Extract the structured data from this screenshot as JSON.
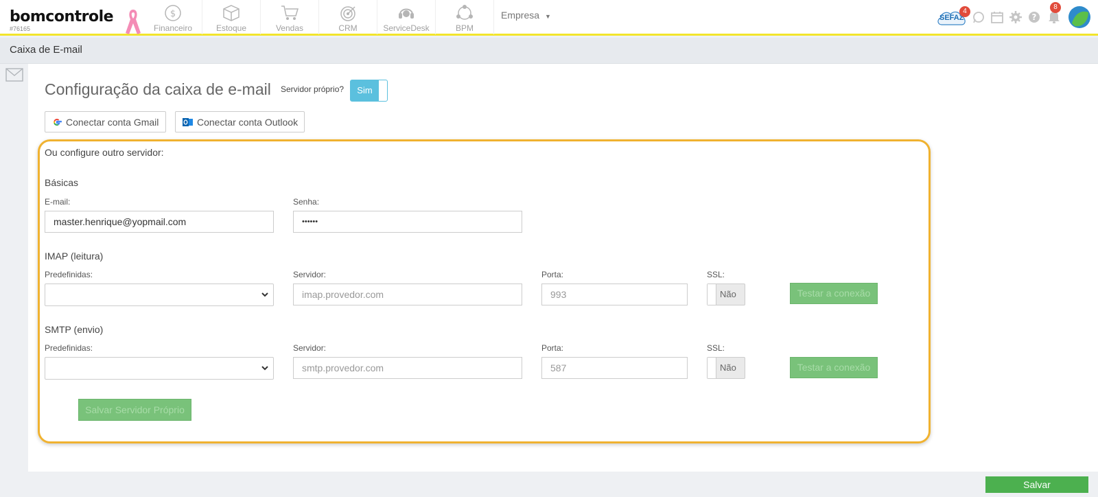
{
  "app": {
    "logo": "bomcontrole",
    "account_code": "#76165",
    "modules": [
      {
        "label": "Financeiro",
        "icon": "dollar-circle-icon"
      },
      {
        "label": "Estoque",
        "icon": "box-icon"
      },
      {
        "label": "Vendas",
        "icon": "cart-icon"
      },
      {
        "label": "CRM",
        "icon": "target-icon"
      },
      {
        "label": "ServiceDesk",
        "icon": "headset-icon"
      },
      {
        "label": "BPM",
        "icon": "network-icon"
      }
    ],
    "company_menu": "Empresa",
    "sefaz_label": "SEFAZ",
    "sefaz_badge": "4",
    "notifications_badge": "8"
  },
  "page": {
    "title": "Caixa de E-mail",
    "heading": "Configuração da caixa de e-mail",
    "own_server_label": "Servidor próprio?",
    "own_server_toggle": "Sim",
    "gmail_button": "Conectar conta Gmail",
    "outlook_button": "Conectar conta Outlook",
    "other_server_label": "Ou configure outro servidor:"
  },
  "basic": {
    "section": "Básicas",
    "email_label": "E-mail:",
    "email_value": "master.henrique@yopmail.com",
    "password_label": "Senha:",
    "password_value": "••••••"
  },
  "imap": {
    "section": "IMAP (leitura)",
    "preset_label": "Predefinidas:",
    "preset_value": "",
    "server_label": "Servidor:",
    "server_placeholder": "imap.provedor.com",
    "port_label": "Porta:",
    "port_placeholder": "993",
    "ssl_label": "SSL:",
    "ssl_value": "Não",
    "test_button": "Testar a conexão"
  },
  "smtp": {
    "section": "SMTP (envio)",
    "preset_label": "Predefinidas:",
    "preset_value": "",
    "server_label": "Servidor:",
    "server_placeholder": "smtp.provedor.com",
    "port_label": "Porta:",
    "port_placeholder": "587",
    "ssl_label": "SSL:",
    "ssl_value": "Não",
    "test_button": "Testar a conexão"
  },
  "actions": {
    "save_own_server": "Salvar Servidor Próprio",
    "save": "Salvar"
  },
  "colors": {
    "accent_yellow": "#f2e52b",
    "highlight_border": "#f0b230",
    "toggle_blue": "#5bc0de",
    "save_green": "#4cb04f"
  }
}
